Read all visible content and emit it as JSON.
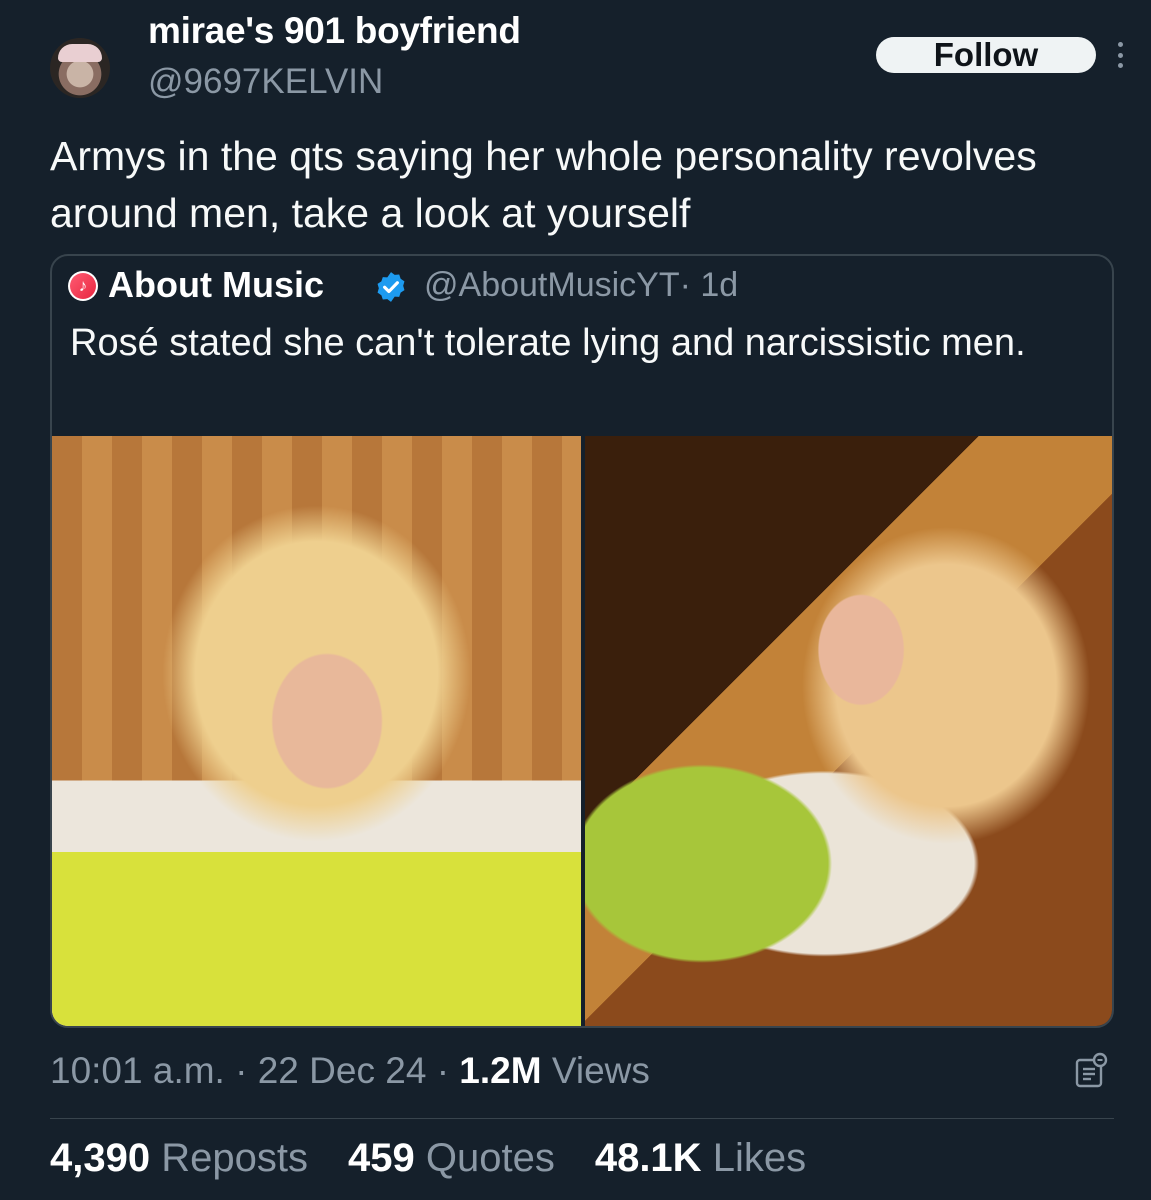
{
  "author": {
    "display_name": "mirae's 901 boyfriend",
    "handle": "@9697KELVIN",
    "avatar_icon": "profile-photo"
  },
  "follow_label": "Follow",
  "tweet_text": "Armys in the qts saying her whole personality revolves around men, take a look at yourself",
  "quoted": {
    "name": "About Music",
    "handle": "@AboutMusicYT",
    "separator": "·",
    "age": "1d",
    "text": "Rosé stated she can't tolerate lying and narcissistic men.",
    "verified_color": "#1d9bf0",
    "avatar_icon": "music-note-icon"
  },
  "footer": {
    "time": "10:01 a.m.",
    "date": "22 Dec 24",
    "views_count": "1.2M",
    "views_label": "Views",
    "sep": "·"
  },
  "stats": [
    {
      "count": "4,390",
      "label": "Reposts"
    },
    {
      "count": "459",
      "label": "Quotes"
    },
    {
      "count": "48.1K",
      "label": "Likes"
    }
  ],
  "colors": {
    "background": "#15202b",
    "secondary_text": "#8b98a5",
    "border": "#38444d"
  }
}
